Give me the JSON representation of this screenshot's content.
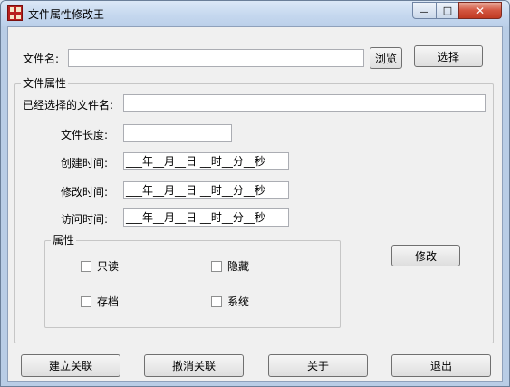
{
  "window": {
    "title": "文件属性修改王",
    "min_glyph": "—",
    "max_glyph": "□",
    "close_glyph": "✕"
  },
  "file": {
    "label": "文件名:",
    "value": "",
    "browse_label": "浏览",
    "select_label": "选择"
  },
  "properties_group": {
    "title": "文件属性",
    "selected_label": "已经选择的文件名:",
    "selected_value": "",
    "length_label": "文件长度:",
    "length_value": "",
    "created_label": "创建时间:",
    "created_value": "___年__月__日 __时__分__秒",
    "modified_label": "修改时间:",
    "modified_value": "___年__月__日 __时__分__秒",
    "accessed_label": "访问时间:",
    "accessed_value": "___年__月__日 __时__分__秒"
  },
  "attributes_group": {
    "title": "属性",
    "readonly": "只读",
    "hidden": "隐藏",
    "archive": "存档",
    "system": "系统"
  },
  "modify_label": "修改",
  "bottom": {
    "associate": "建立关联",
    "unassociate": "撤消关联",
    "about": "关于",
    "exit": "退出"
  }
}
